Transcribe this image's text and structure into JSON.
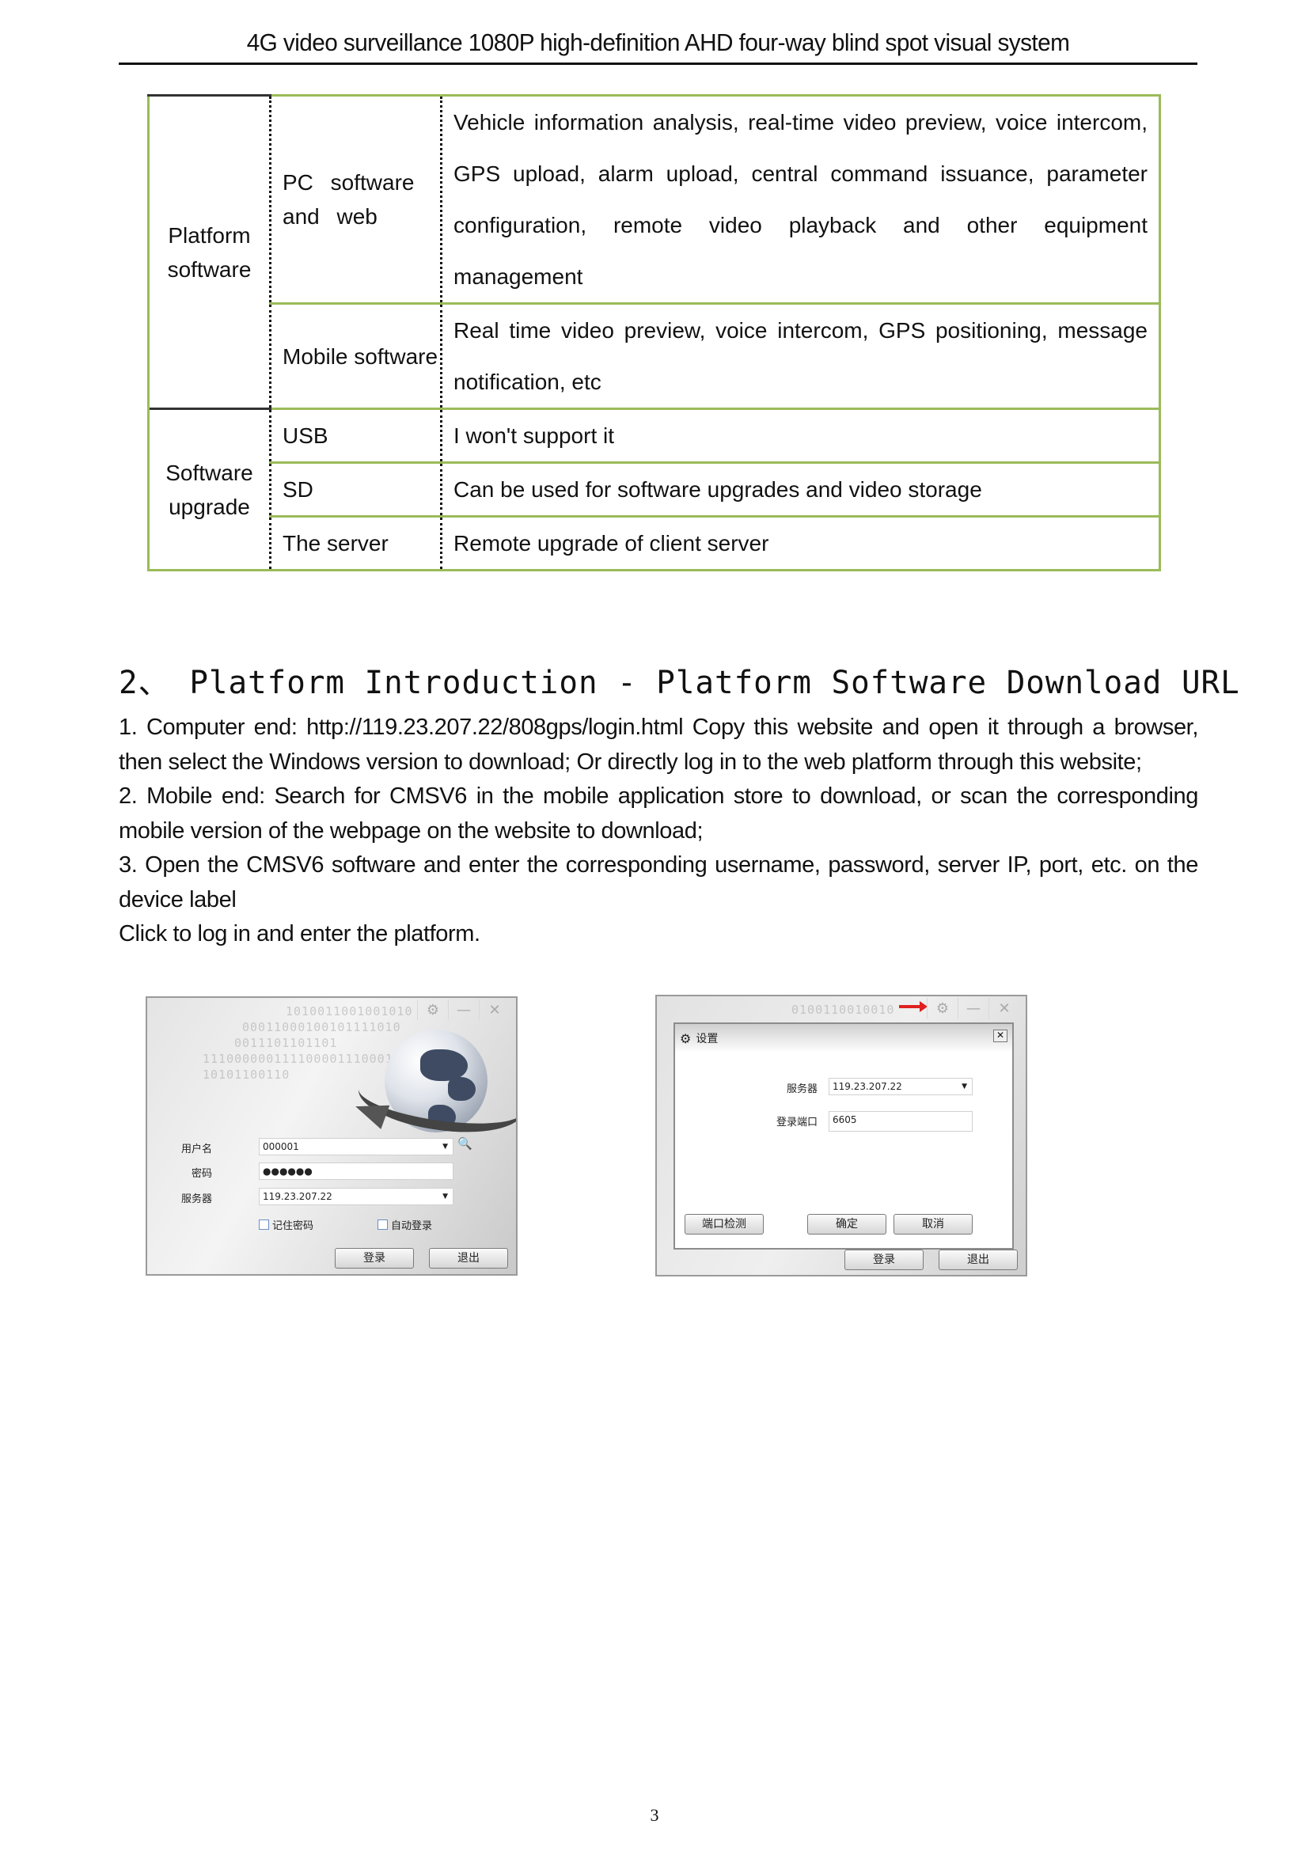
{
  "header": {
    "title": "4G video surveillance 1080P high-definition AHD four-way blind spot visual system"
  },
  "spec_table": {
    "groups": [
      {
        "category": "Platform software",
        "rows": [
          {
            "item": "PC software and web",
            "description": "Vehicle information analysis, real-time video preview, voice intercom, GPS upload, alarm upload, central command issuance, parameter configuration, remote video playback and other equipment management"
          },
          {
            "item": "Mobile software",
            "description": "Real time video preview, voice intercom, GPS positioning, message notification, etc"
          }
        ]
      },
      {
        "category": "Software upgrade",
        "rows": [
          {
            "item": "USB",
            "description": "I won't support it"
          },
          {
            "item": "SD",
            "description": "Can be used for software upgrades and video storage"
          },
          {
            "item": "The server",
            "description": "Remote upgrade of client server"
          }
        ]
      }
    ],
    "border_color": "#9bbb59"
  },
  "section": {
    "title": "2、 Platform Introduction - Platform Software Download URL",
    "paragraphs": [
      "1. Computer end: http://119.23.207.22/808gps/login.html Copy this website and open it through a browser, then select the Windows version to download; Or directly log in to the web platform through this website;",
      "2. Mobile end: Search for CMSV6 in the mobile application store to download, or scan the corresponding mobile version of the webpage on the website to download;",
      "3. Open the CMSV6 software and enter the corresponding username, password, server IP, port, etc. on the device label",
      "Click to log in and enter the platform."
    ]
  },
  "login_window": {
    "binary_lines": [
      "1010011001001010",
      "00011000100101111010",
      "0011101101101",
      "1110000001111000011100010",
      "10101100110"
    ],
    "title_buttons": {
      "settings": "⚙",
      "minimize": "—",
      "close": "✕"
    },
    "username_label": "用户名",
    "username_value": "000001",
    "password_label": "密码",
    "password_value": "●●●●●●",
    "server_label": "服务器",
    "server_value": "119.23.207.22",
    "remember_password": "记住密码",
    "auto_login": "自动登录",
    "login_button": "登录",
    "exit_button": "退出"
  },
  "settings_window": {
    "binary_line": "0100110010010",
    "title_buttons": {
      "settings": "⚙",
      "minimize": "—",
      "close": "✕"
    },
    "dialog_title": "设置",
    "dialog_close": "✕",
    "server_label": "服务器",
    "server_value": "119.23.207.22",
    "port_label": "登录端口",
    "port_value": "6605",
    "port_check_button": "端口检测",
    "ok_button": "确定",
    "cancel_button": "取消",
    "login_button": "登录",
    "exit_button": "退出",
    "arrow_color": "#e02020"
  },
  "footer": {
    "page_number": "3"
  }
}
